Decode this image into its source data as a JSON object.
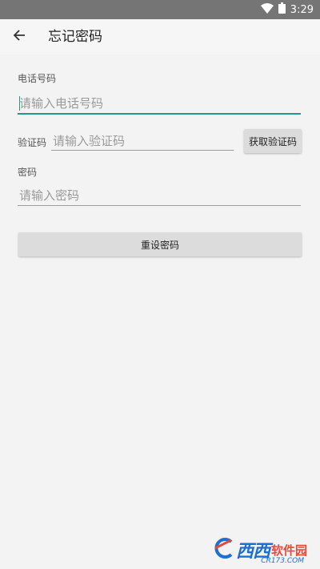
{
  "status_bar": {
    "time": "3:29",
    "wifi_icon": "wifi-icon",
    "battery_icon": "battery-icon"
  },
  "app_bar": {
    "title": "忘记密码",
    "back_icon": "arrow-back-icon"
  },
  "form": {
    "phone": {
      "label": "电话号码",
      "placeholder": "请输入电话号码",
      "value": ""
    },
    "code": {
      "label": "验证码",
      "placeholder": "请输入验证码",
      "value": "",
      "get_code_button": "获取验证码"
    },
    "password": {
      "label": "密码",
      "placeholder": "请输入密码",
      "value": ""
    },
    "submit_button": "重设密码"
  },
  "watermark": {
    "logo_text": "西西",
    "text": "软件园",
    "url": "CR173.COM"
  },
  "colors": {
    "accent": "#1e9c8a",
    "status_bar": "#757575",
    "button": "#dcdcdc"
  }
}
